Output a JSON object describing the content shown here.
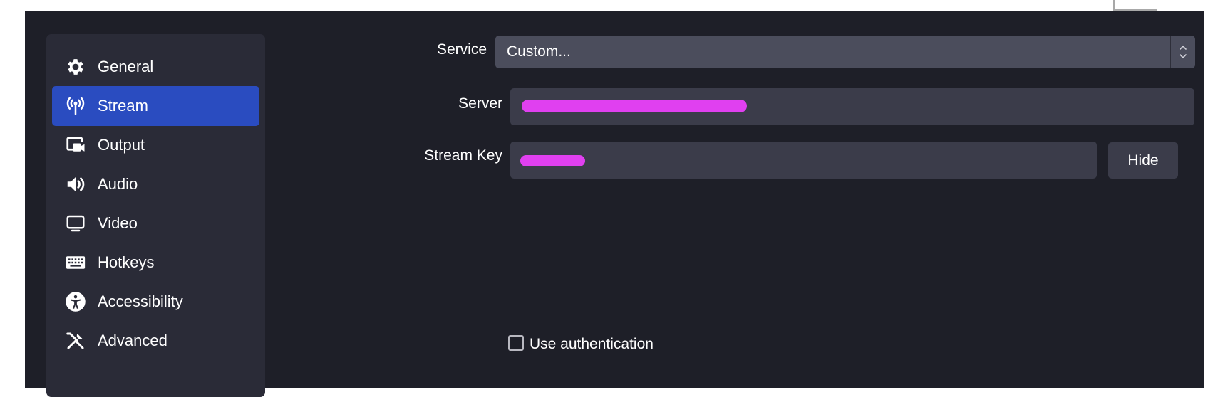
{
  "sidebar": {
    "items": [
      {
        "label": "General",
        "icon": "gear-icon"
      },
      {
        "label": "Stream",
        "icon": "antenna-icon",
        "active": true
      },
      {
        "label": "Output",
        "icon": "output-icon"
      },
      {
        "label": "Audio",
        "icon": "speaker-icon"
      },
      {
        "label": "Video",
        "icon": "monitor-icon"
      },
      {
        "label": "Hotkeys",
        "icon": "keyboard-icon"
      },
      {
        "label": "Accessibility",
        "icon": "accessibility-icon"
      },
      {
        "label": "Advanced",
        "icon": "tools-icon"
      }
    ]
  },
  "form": {
    "service_label": "Service",
    "service_value": "Custom...",
    "server_label": "Server",
    "server_value_redacted": true,
    "stream_key_label": "Stream Key",
    "stream_key_redacted": true,
    "hide_button": "Hide",
    "use_auth_label": "Use authentication",
    "use_auth_checked": false
  },
  "colors": {
    "window_bg": "#1e1f28",
    "sidebar_bg": "#2a2b37",
    "active_item": "#2a4cc0",
    "field_bg": "#3b3c4a",
    "redaction": "#e040f0"
  }
}
